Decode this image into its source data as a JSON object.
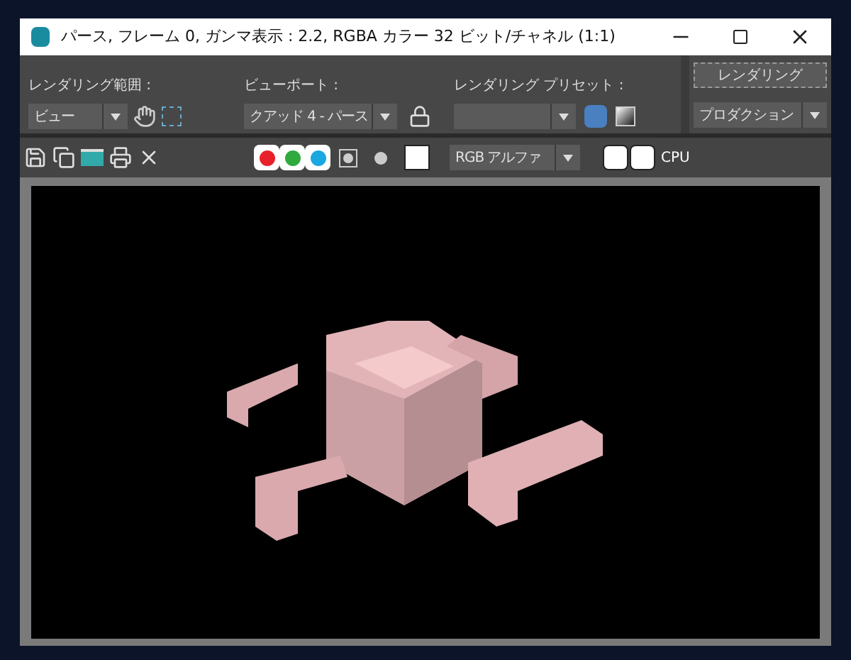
{
  "window": {
    "title": "パース, フレーム 0, ガンマ表示 : 2.2, RGBA カラー 32 ビット/チャネル (1:1)"
  },
  "toolbar": {
    "groups": [
      {
        "label": "レンダリング範囲 :",
        "value": "ビュー"
      },
      {
        "label": "ビューポート :",
        "value": "クアッド 4 - パース"
      },
      {
        "label": "レンダリング プリセット :"
      }
    ],
    "render_button": "レンダリング",
    "mode": "プロダクション"
  },
  "channels": [
    {
      "color": "#e8202a",
      "on": true
    },
    {
      "color": "#2eaa3e",
      "on": true
    },
    {
      "color": "#19a8e0",
      "on": true
    }
  ],
  "display_select": "RGB アルファ",
  "cpu_label": "CPU"
}
